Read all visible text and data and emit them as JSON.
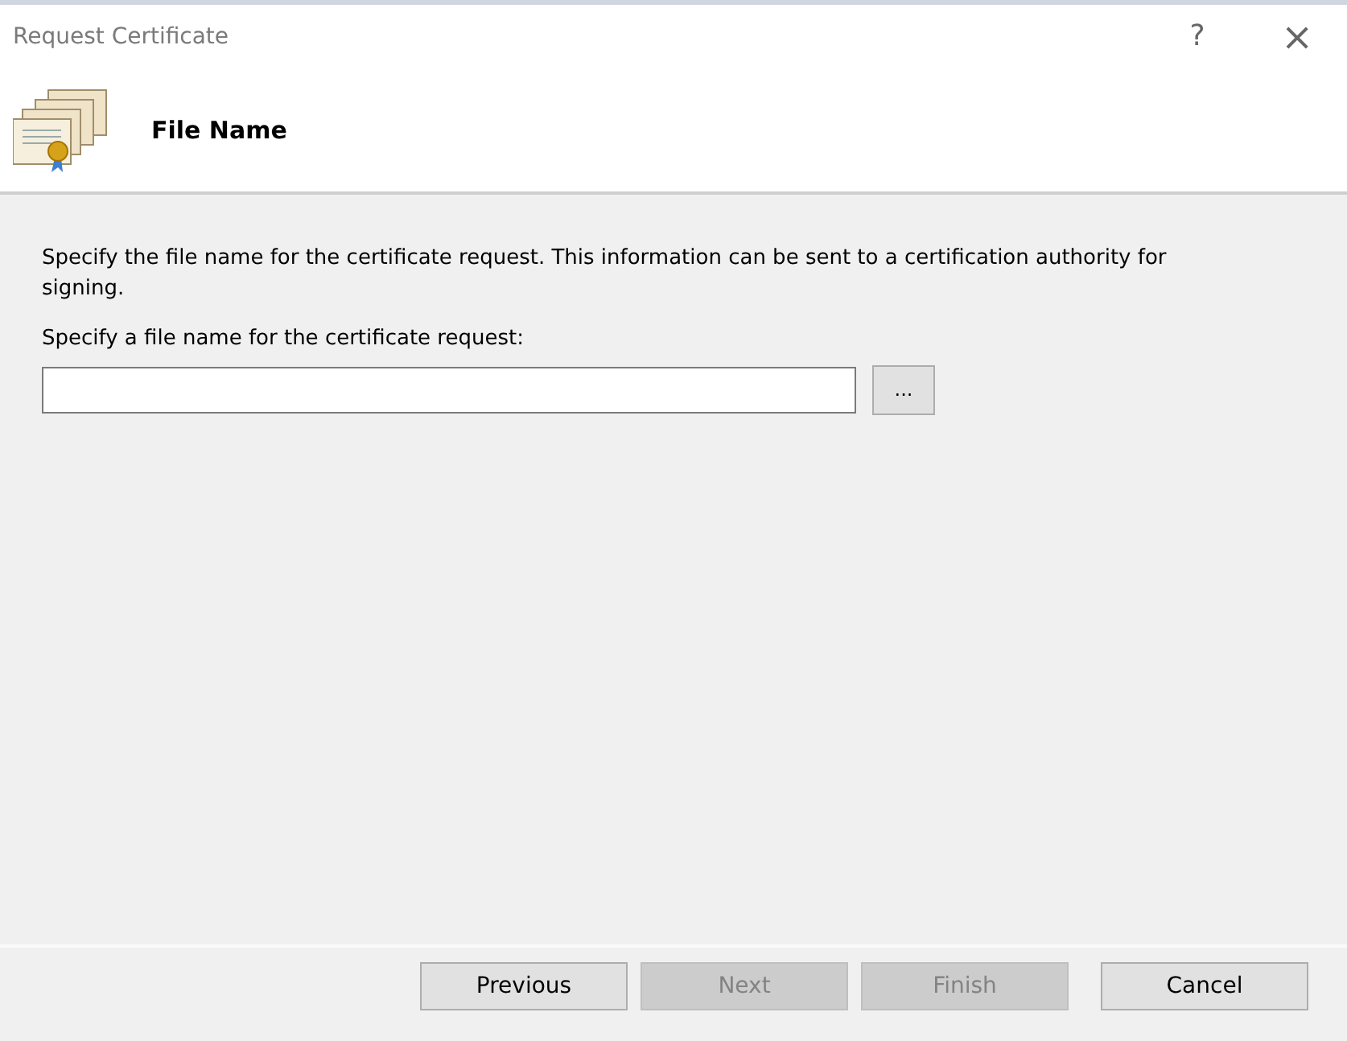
{
  "window": {
    "title": "Request Certificate",
    "help": "?",
    "close": "×"
  },
  "header": {
    "title": "File Name"
  },
  "description": "Specify the file name for the certificate request. This information can be sent to a certification authority for signing.",
  "file_field": {
    "label": "Specify a file name for the certificate request:",
    "browse": "..."
  },
  "buttons": [
    {
      "label": "Previous",
      "disabled": false
    },
    {
      "label": "Next",
      "disabled": true
    },
    {
      "label": "Finish",
      "disabled": true
    },
    {
      "label": "Cancel",
      "disabled": false
    }
  ]
}
